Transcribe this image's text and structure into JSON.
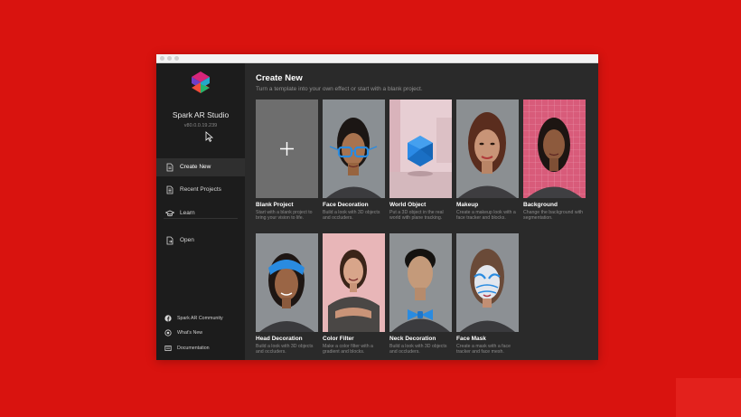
{
  "app": {
    "name": "Spark AR Studio",
    "version": "v80.0.0.19.239"
  },
  "sidebar": {
    "items": [
      {
        "id": "create-new",
        "label": "Create New",
        "icon": "new-file-icon",
        "active": true
      },
      {
        "id": "recent-projects",
        "label": "Recent Projects",
        "icon": "document-icon",
        "active": false
      },
      {
        "id": "learn",
        "label": "Learn",
        "icon": "graduation-cap-icon",
        "active": false
      },
      {
        "id": "open",
        "label": "Open",
        "icon": "open-file-icon",
        "active": false
      }
    ],
    "footer": [
      {
        "id": "community",
        "label": "Spark AR Community",
        "icon": "facebook-icon"
      },
      {
        "id": "whats-new",
        "label": "What's New",
        "icon": "radio-dot-icon"
      },
      {
        "id": "documentation",
        "label": "Documentation",
        "icon": "book-icon"
      }
    ]
  },
  "main": {
    "title": "Create New",
    "subtitle": "Turn a template into your own effect or start with a blank project.",
    "templates": [
      {
        "title": "Blank Project",
        "desc": "Start with a blank project to bring your vision to life.",
        "icon": "plus-icon"
      },
      {
        "title": "Face Decoration",
        "desc": "Build a look with 3D objects and occluders.",
        "icon": "glasses-icon"
      },
      {
        "title": "World Object",
        "desc": "Put a 3D object in the real world with plane tracking.",
        "icon": "icosahedron-icon"
      },
      {
        "title": "Makeup",
        "desc": "Create a makeup look with a face tracker and blocks.",
        "icon": "face-icon"
      },
      {
        "title": "Background",
        "desc": "Change the background with segmentation.",
        "icon": "grid-background-icon"
      },
      {
        "title": "Head Decoration",
        "desc": "Build a look with 3D objects and occluders.",
        "icon": "headband-icon"
      },
      {
        "title": "Color Filter",
        "desc": "Make a color filter with a gradient and blocks.",
        "icon": "color-filter-icon"
      },
      {
        "title": "Neck Decoration",
        "desc": "Build a look with 3D objects and occluders.",
        "icon": "bowtie-icon"
      },
      {
        "title": "Face Mask",
        "desc": "Create a mask with a face tracker and face mesh.",
        "icon": "face-mask-icon"
      }
    ]
  },
  "colors": {
    "background": "#d9130f",
    "sidebar": "#1c1c1c",
    "main": "#2a2a2a",
    "accent_blue": "#2a8be0"
  }
}
